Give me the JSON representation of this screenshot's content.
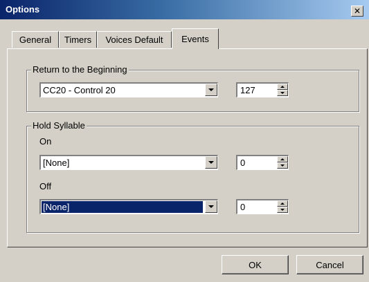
{
  "window": {
    "title": "Options",
    "close_glyph": "✕",
    "title_bar_color": "#0a246a"
  },
  "tabs": [
    {
      "label": "General",
      "active": false
    },
    {
      "label": "Timers",
      "active": false
    },
    {
      "label": "Voices Default",
      "active": false
    },
    {
      "label": "Events",
      "active": true
    }
  ],
  "return_group": {
    "legend": "Return to the Beginning",
    "combo_value": "CC20 - Control 20",
    "spin_value": "127"
  },
  "hold_group": {
    "legend": "Hold Syllable",
    "on_label": "On",
    "on_combo_value": "[None]",
    "on_spin_value": "0",
    "off_label": "Off",
    "off_combo_value": "[None]",
    "off_spin_value": "0",
    "selection_color": "#0a246a"
  },
  "buttons": {
    "ok_label": "OK",
    "cancel_label": "Cancel"
  },
  "icons": [
    "close-icon",
    "dropdown-arrow-icon",
    "spin-up-icon",
    "spin-down-icon"
  ]
}
